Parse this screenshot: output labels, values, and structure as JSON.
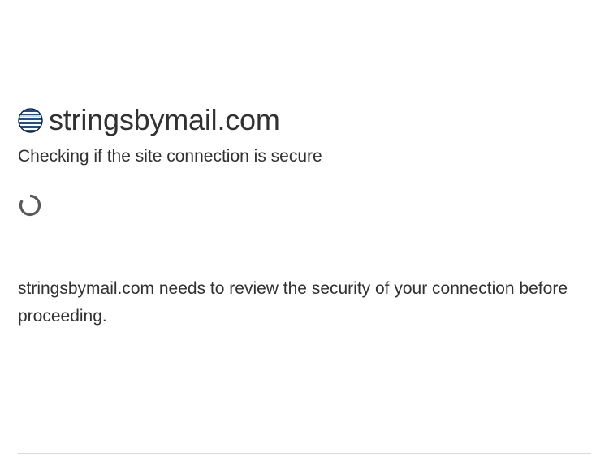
{
  "site": {
    "domain": "stringsbymail.com",
    "favicon": "striped-globe-icon"
  },
  "challenge": {
    "subtitle": "Checking if the site connection is secure",
    "spinner": "loading-spinner-icon",
    "message": "stringsbymail.com needs to review the security of your connection before proceeding."
  },
  "colors": {
    "text": "#313131",
    "favicon_blue": "#1f4e8c",
    "spinner": "#595959",
    "rule": "#d9d9d9"
  }
}
